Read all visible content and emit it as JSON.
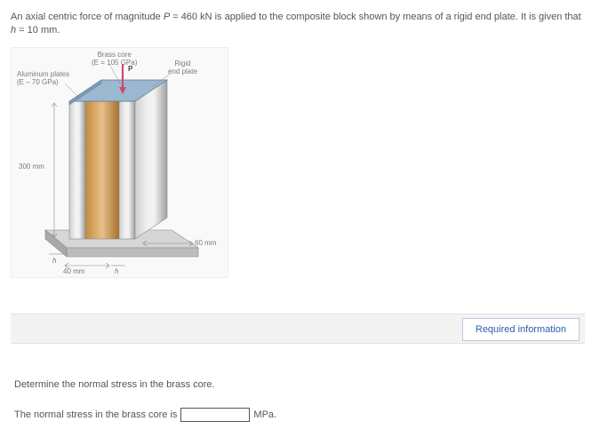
{
  "problem": {
    "text_parts": {
      "a": "An axial centric force of magnitude ",
      "pvar": "P",
      "b": " = 460 kN is applied to the composite block shown by means of a rigid end plate. It is given that ",
      "hvar": "h",
      "c": " = 10 mm."
    }
  },
  "figure": {
    "labels": {
      "brass_core_l1": "Brass core",
      "brass_core_l2": "(E = 105 GPa)",
      "alum_l1": "Aluminum plates",
      "alum_l2": "(E – 70 GPa)",
      "rigid_l1": "Rigid",
      "rigid_l2": "end plate",
      "p_arrow": "P",
      "height": "300 mm",
      "width_60": "60 mm",
      "width_40": "40 mm",
      "h1": "h",
      "h2": "h"
    }
  },
  "tabs": {
    "required_info": "Required information"
  },
  "question": {
    "prompt": "Determine the normal stress in the brass core.",
    "answer_prefix": "The normal stress in the brass core is",
    "answer_value": "",
    "answer_unit": "MPa."
  }
}
